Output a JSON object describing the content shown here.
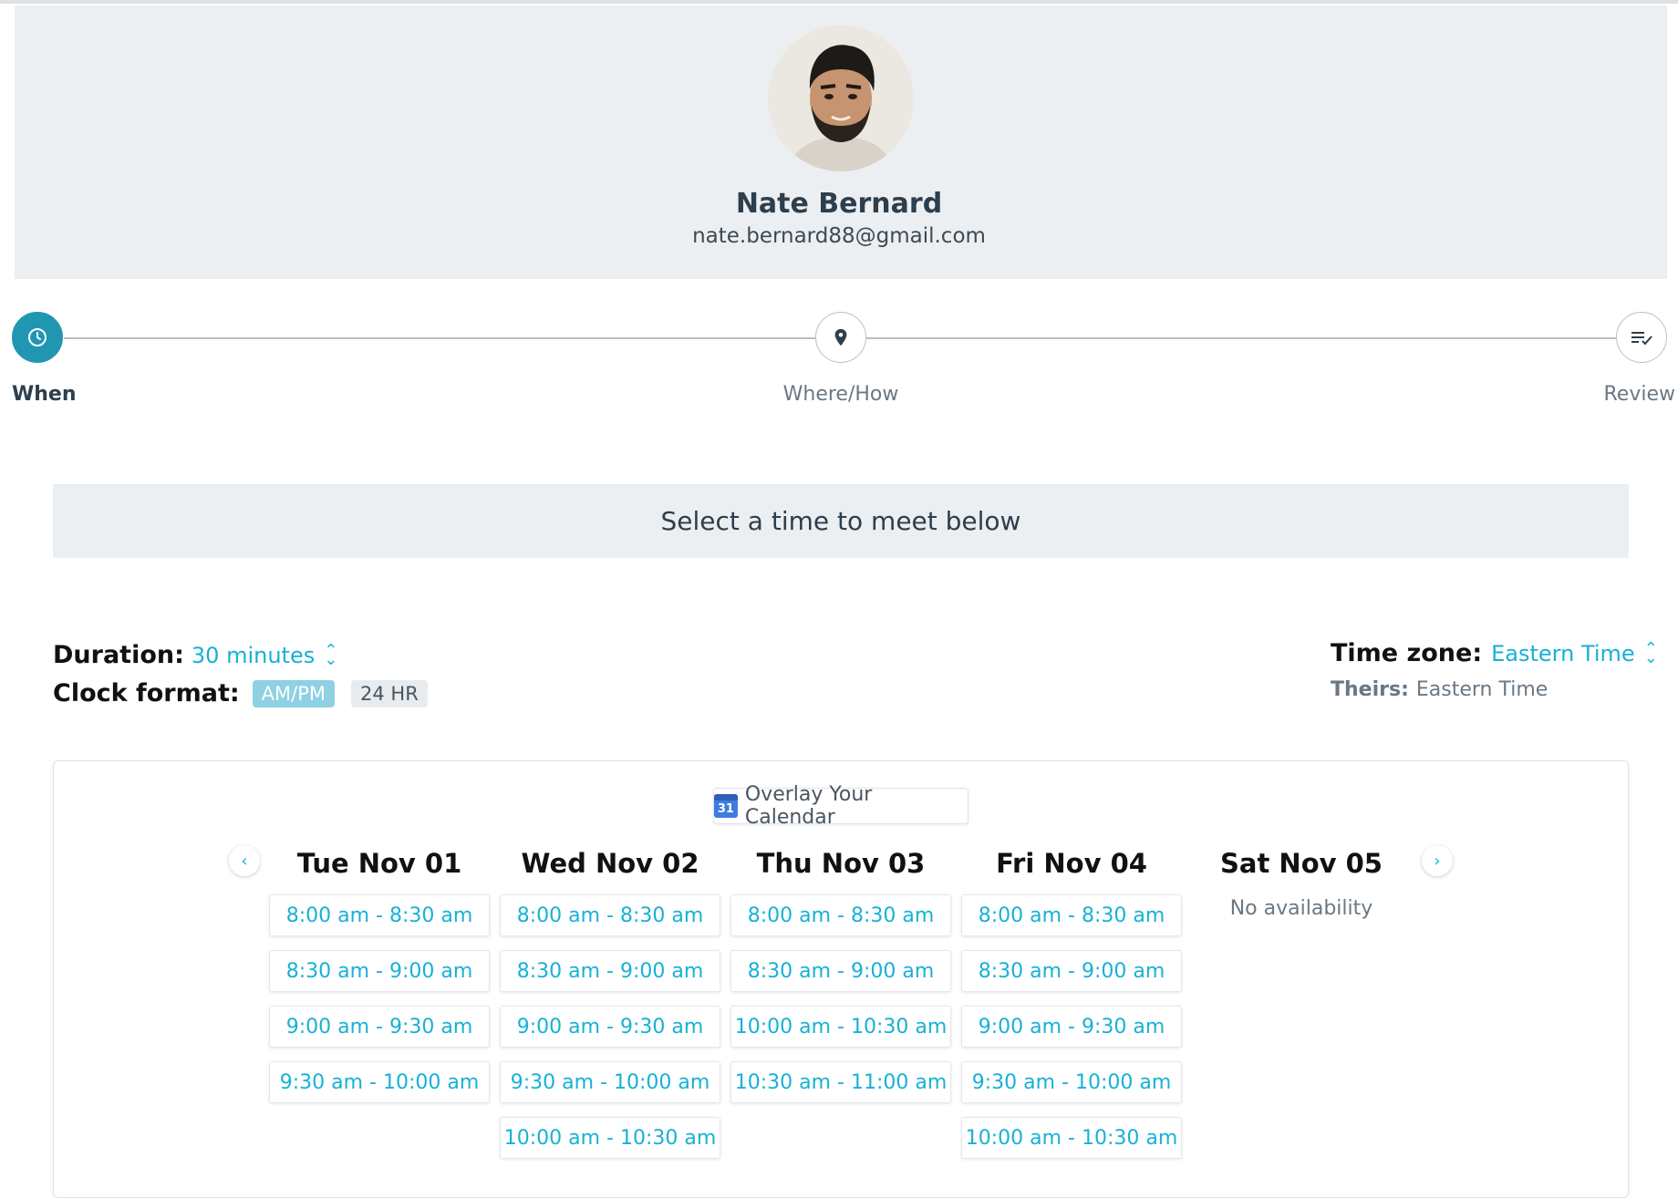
{
  "host": {
    "name": "Nate Bernard",
    "email": "nate.bernard88@gmail.com"
  },
  "steps": [
    {
      "label": "When",
      "icon": "clock-icon",
      "active": true
    },
    {
      "label": "Where/How",
      "icon": "location-pin-icon",
      "active": false
    },
    {
      "label": "Review",
      "icon": "checklist-icon",
      "active": false
    }
  ],
  "banner": "Select a time to meet below",
  "options": {
    "duration_label": "Duration:",
    "duration_value": "30 minutes",
    "clock_label": "Clock format:",
    "clock_ampm": "AM/PM",
    "clock_24": "24 HR",
    "timezone_label": "Time zone:",
    "timezone_value": "Eastern Time",
    "theirs_label": "Theirs:",
    "theirs_value": "Eastern Time"
  },
  "overlay_button": "Overlay Your Calendar",
  "calendar_icon_text": "31",
  "days": [
    {
      "label": "Tue Nov 01",
      "slots": [
        "8:00 am - 8:30 am",
        "8:30 am - 9:00 am",
        "9:00 am - 9:30 am",
        "9:30 am - 10:00 am"
      ]
    },
    {
      "label": "Wed Nov 02",
      "slots": [
        "8:00 am - 8:30 am",
        "8:30 am - 9:00 am",
        "9:00 am - 9:30 am",
        "9:30 am - 10:00 am",
        "10:00 am - 10:30 am"
      ]
    },
    {
      "label": "Thu Nov 03",
      "slots": [
        "8:00 am - 8:30 am",
        "8:30 am - 9:00 am",
        "10:00 am - 10:30 am",
        "10:30 am - 11:00 am"
      ]
    },
    {
      "label": "Fri Nov 04",
      "slots": [
        "8:00 am - 8:30 am",
        "8:30 am - 9:00 am",
        "9:00 am - 9:30 am",
        "9:30 am - 10:00 am",
        "10:00 am - 10:30 am"
      ]
    },
    {
      "label": "Sat Nov 05",
      "slots": [],
      "empty_text": "No availability"
    }
  ],
  "colors": {
    "accent": "#17b1d6",
    "step_active": "#2196b3",
    "header_bg": "#eceff2"
  }
}
